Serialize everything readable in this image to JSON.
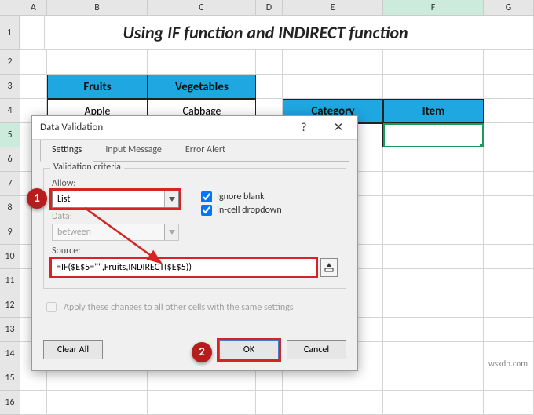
{
  "columns": [
    "A",
    "B",
    "C",
    "D",
    "E",
    "F",
    "G"
  ],
  "rows": [
    "1",
    "2",
    "3",
    "4",
    "5",
    "6",
    "7",
    "8",
    "9",
    "10",
    "11",
    "12",
    "13",
    "14",
    "15",
    "16"
  ],
  "title": "Using IF function and INDIRECT function",
  "table1": {
    "headers": [
      "Fruits",
      "Vegetables"
    ],
    "row1": [
      "Apple",
      "Cabbage"
    ]
  },
  "table2": {
    "headers": [
      "Category",
      "Item"
    ]
  },
  "dialog": {
    "title": "Data Validation",
    "help": "?",
    "close": "✕",
    "tabs": [
      "Settings",
      "Input Message",
      "Error Alert"
    ],
    "group": "Validation criteria",
    "allow_label": "Allow:",
    "allow_value": "List",
    "data_label": "Data:",
    "data_value": "between",
    "ignore_blank": "Ignore blank",
    "incell": "In-cell dropdown",
    "source_label": "Source:",
    "source_value": "=IF($E$5=\"\",Fruits,INDIRECT($E$5))",
    "apply_txt": "Apply these changes to all other cells with the same settings",
    "clear": "Clear All",
    "ok": "OK",
    "cancel": "Cancel"
  },
  "markers": {
    "m1": "1",
    "m2": "2"
  },
  "watermark": "wsxdn.com"
}
